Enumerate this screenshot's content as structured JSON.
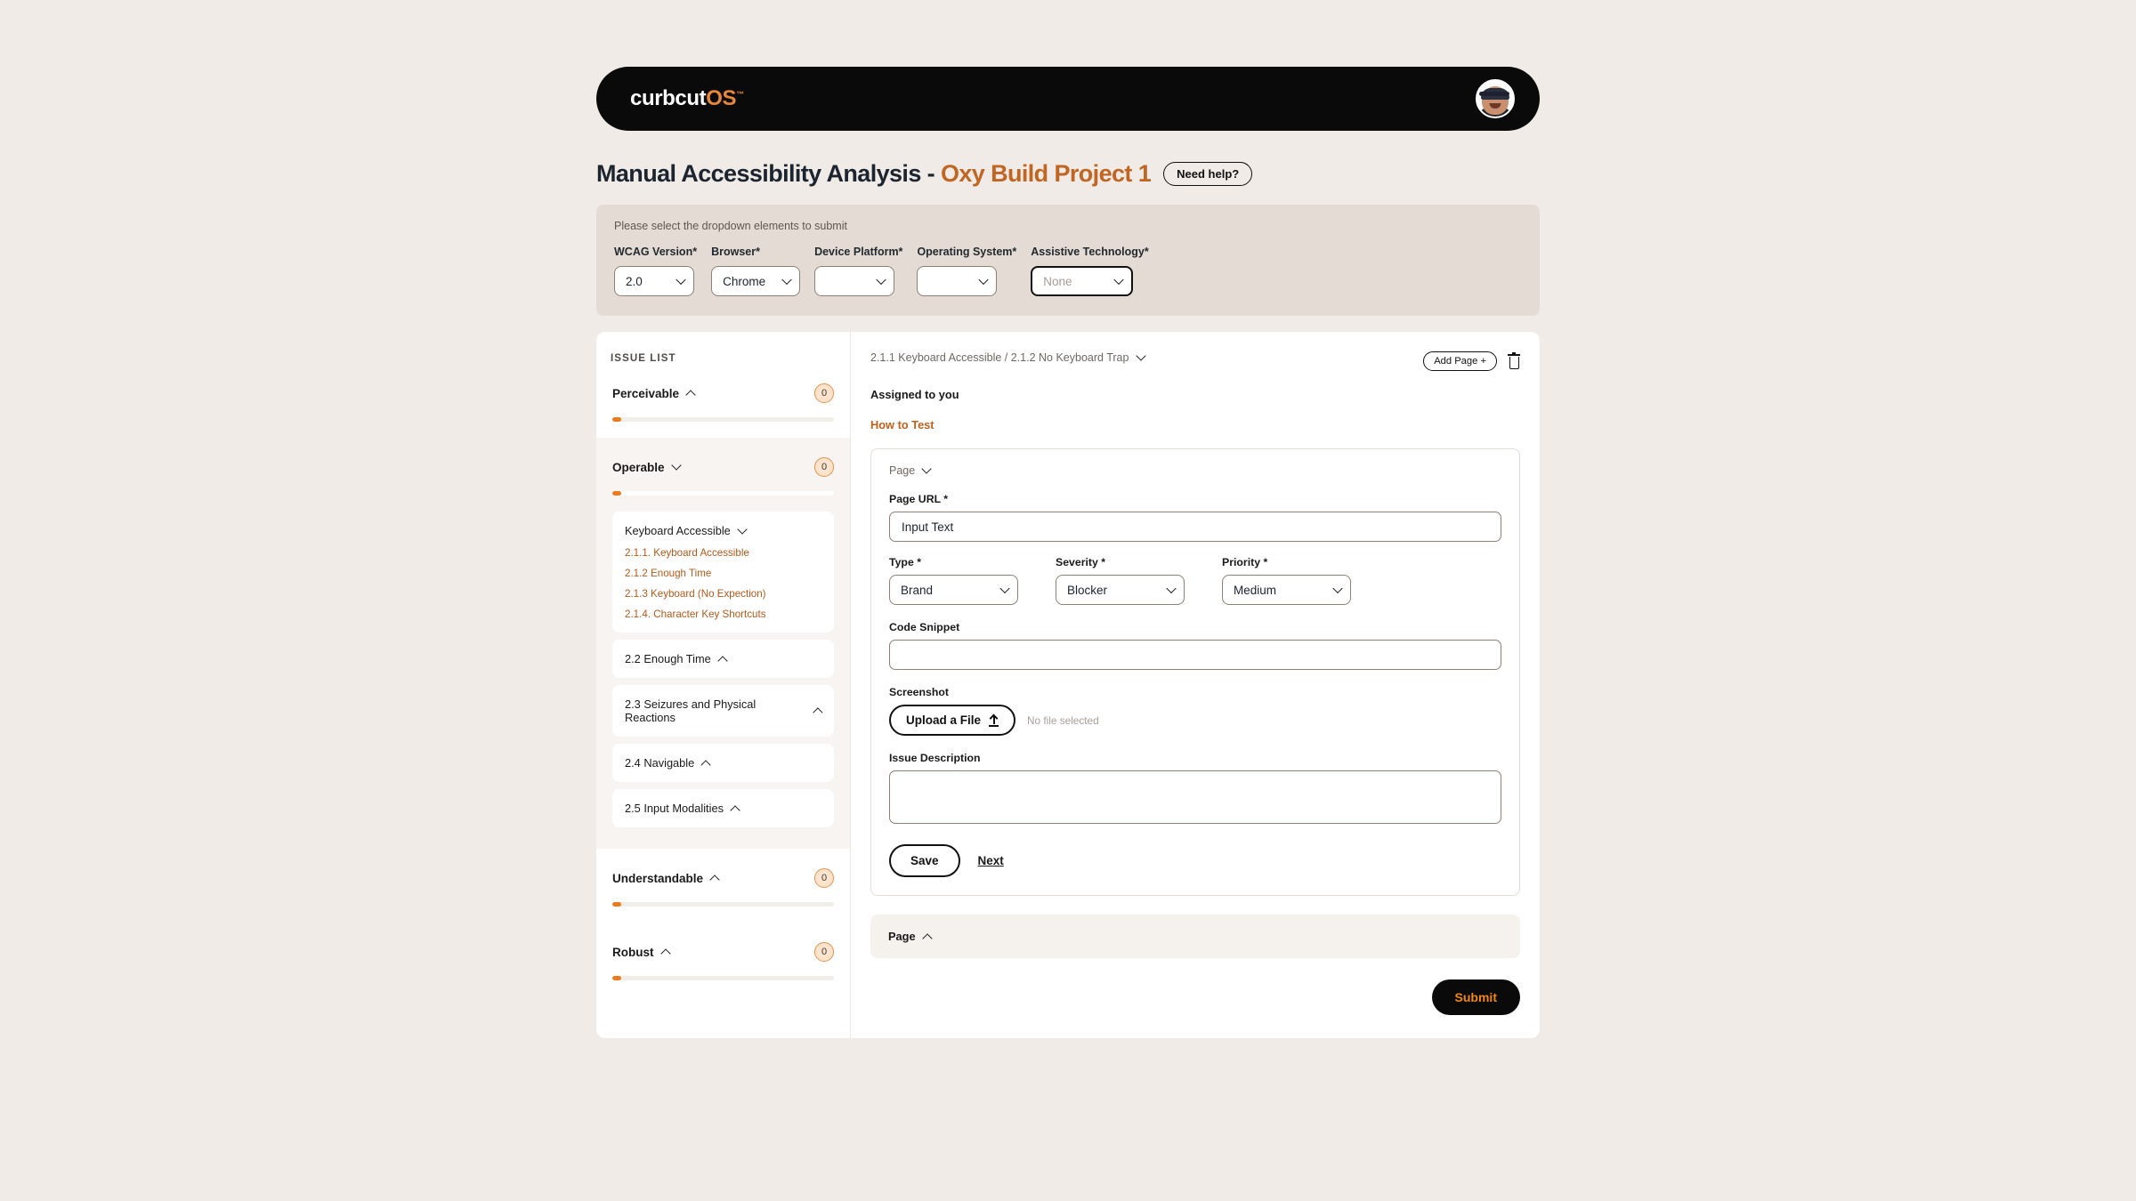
{
  "navbar": {
    "logo_main": "curbcut",
    "logo_os": "OS",
    "logo_tm": "™",
    "avatar_alt": "user-avatar"
  },
  "header": {
    "title_main": "Manual Accessibility Analysis - ",
    "title_project": "Oxy Build Project 1",
    "help_label": "Need help?"
  },
  "filters": {
    "hint": "Please select the dropdown elements to submit",
    "fields": [
      {
        "label": "WCAG Version*",
        "value": "2.0",
        "placeholder": ""
      },
      {
        "label": "Browser*",
        "value": "Chrome",
        "placeholder": ""
      },
      {
        "label": "Device Platform*",
        "value": "",
        "placeholder": ""
      },
      {
        "label": "Operating System*",
        "value": "",
        "placeholder": ""
      },
      {
        "label": "Assistive Technology*",
        "value": "",
        "placeholder": "None"
      }
    ]
  },
  "sidebar": {
    "heading": "ISSUE LIST",
    "principles": [
      {
        "name": "Perceivable",
        "count": "0",
        "caret": "chevron-up",
        "progress": 4
      },
      {
        "name": "Operable",
        "count": "0",
        "caret": "chevron-down",
        "progress": 4
      },
      {
        "name": "Understandable",
        "count": "0",
        "caret": "chevron-up",
        "progress": 4
      },
      {
        "name": "Robust",
        "count": "0",
        "caret": "chevron-up",
        "progress": 4
      }
    ],
    "operable_subgroups": [
      {
        "title": "Keyboard Accessible",
        "caret": "chevron-down",
        "criteria": [
          "2.1.1. Keyboard Accessible",
          "2.1.2 Enough Time",
          "2.1.3 Keyboard (No Expection)",
          "2.1.4. Character Key Shortcuts"
        ]
      },
      {
        "title": "2.2 Enough Time",
        "caret": "chevron-up",
        "criteria": []
      },
      {
        "title": "2.3 Seizures and Physical Reactions",
        "caret": "chevron-up",
        "criteria": []
      },
      {
        "title": "2.4 Navigable",
        "caret": "chevron-up",
        "criteria": []
      },
      {
        "title": "2.5 Input Modalities",
        "caret": "chevron-up",
        "criteria": []
      }
    ]
  },
  "main": {
    "breadcrumb": "2.1.1 Keyboard Accessible / 2.1.2 No Keyboard Trap",
    "add_page_label": "Add Page +",
    "delete_icon": "trash-icon",
    "assigned_label": "Assigned to you",
    "how_to_test_label": "How to Test",
    "form": {
      "page_toggle_label": "Page",
      "page_url_label": "Page URL *",
      "page_url_value": "Input Text",
      "type_label": "Type *",
      "type_value": "Brand",
      "severity_label": "Severity *",
      "severity_value": "Blocker",
      "priority_label": "Priority *",
      "priority_value": "Medium",
      "code_snippet_label": "Code Snippet",
      "code_snippet_value": "",
      "screenshot_label": "Screenshot",
      "upload_label": "Upload a File",
      "no_file_text": "No file selected",
      "issue_description_label": "Issue Description",
      "issue_description_value": "",
      "save_label": "Save",
      "next_label": "Next"
    },
    "second_page_accordion_label": "Page",
    "submit_label": "Submit"
  },
  "colors": {
    "page_bg": "#F0EBE6",
    "nav_bg": "#0A0A0A",
    "accent_orange": "#C06522",
    "link_orange": "#B4591B",
    "submit_text": "#F2860F",
    "filter_bar_bg": "#E4DCD4",
    "title_navy": "#1C2430"
  }
}
